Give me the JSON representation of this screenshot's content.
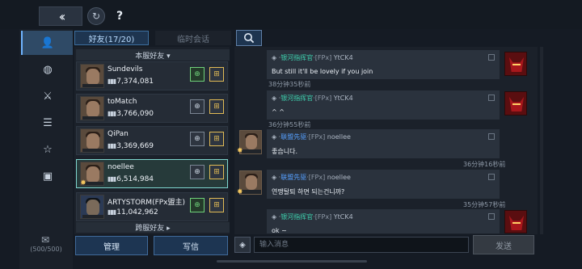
{
  "topbar": {
    "back_icon": "double-chevron-left-icon",
    "refresh_icon": "refresh-icon",
    "help_label": "?"
  },
  "nav": {
    "items": [
      {
        "icon": "person-icon",
        "glyph": "👤",
        "active": true
      },
      {
        "icon": "globe-icon",
        "glyph": "◍"
      },
      {
        "icon": "crossed-swords-icon",
        "glyph": "⚔"
      },
      {
        "icon": "notes-icon",
        "glyph": "☰"
      },
      {
        "icon": "star-icon",
        "glyph": "☆"
      },
      {
        "icon": "gift-icon",
        "glyph": "▣"
      }
    ],
    "mail_count": "(500/500)"
  },
  "tabs": {
    "friends": "好友(17/20)",
    "temp_chat": "临时会话"
  },
  "friend_list": {
    "server_header": "本服好友 ▾",
    "cross_header": "跨服好友 ▸",
    "friends": [
      {
        "name": "Sundevils",
        "power": "7,374,081",
        "action1_active": true
      },
      {
        "name": "toMatch",
        "power": "3,766,090",
        "action1_active": false
      },
      {
        "name": "QiPan",
        "power": "3,369,669",
        "action1_active": false
      },
      {
        "name": "noellee",
        "power": "6,514,984",
        "action1_active": false,
        "selected": true
      },
      {
        "name": "ARTYSTORM(FPx盟主)",
        "power": "11,042,962",
        "action1_active": true
      }
    ]
  },
  "buttons": {
    "manage": "管理",
    "write": "写信",
    "send": "发送"
  },
  "chat": {
    "messages": [
      {
        "side": "right",
        "pre": "◈ ·",
        "rank": "银河指挥官",
        "guild": "·[FPx]",
        "name": "YtCK4",
        "text": "But still it'll be lovely if you join",
        "time": "38分钟35秒前",
        "avatar": "red"
      },
      {
        "side": "right",
        "pre": "◈ ·",
        "rank": "银河指挥官",
        "guild": "·[FPx]",
        "name": "YtCK4",
        "text": "^ ^",
        "time": "36分钟55秒前",
        "avatar": "red"
      },
      {
        "side": "left",
        "pre": "◈ ·",
        "rank": "联盟先驱",
        "guild": "·[FPx]",
        "name": "noellee",
        "text": "좋습니다.",
        "time": "36分钟16秒前",
        "avatar": "man"
      },
      {
        "side": "left",
        "pre": "◈ ·",
        "rank": "联盟先驱",
        "guild": "·[FPx]",
        "name": "noellee",
        "text": "연맹탈퇴 하면 되는건니까?",
        "time": "35分钟57秒前",
        "avatar": "man"
      },
      {
        "side": "right",
        "pre": "◈ ·",
        "rank": "银河指挥官",
        "guild": "·[FPx]",
        "name": "YtCK4",
        "text": "ok ~",
        "time": "",
        "avatar": "red"
      }
    ],
    "input_placeholder": "输入消息"
  }
}
